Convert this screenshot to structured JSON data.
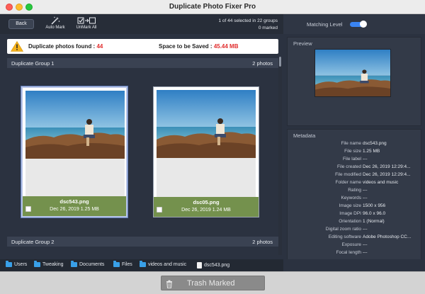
{
  "window": {
    "title": "Duplicate Photo Fixer Pro"
  },
  "toolbar": {
    "back_label": "Back",
    "auto_mark_label": "Auto Mark",
    "unmark_all_label": "UnMark All",
    "selection_info": "1 of 44 selected in 22 groups",
    "marked_info": "0 marked"
  },
  "matching": {
    "label": "Matching Level",
    "enabled": true,
    "accent": "#3a84f2"
  },
  "banner": {
    "dup_label": "Duplicate photos found : ",
    "dup_count": "44",
    "space_label": "Space to be Saved : ",
    "space_value": "45.44 MB",
    "value_color": "#e02a2a"
  },
  "groups": [
    {
      "name": "Duplicate Group 1",
      "count": "2 photos"
    },
    {
      "name": "Duplicate Group 2",
      "count": "2 photos"
    }
  ],
  "photos": [
    {
      "name": "dsc543.png",
      "meta": "Dec 26, 2019 1.25 MB",
      "selected": true,
      "checked": false
    },
    {
      "name": "dsc05.png",
      "meta": "Dec 26, 2019 1.24 MB",
      "selected": false,
      "checked": false
    }
  ],
  "preview": {
    "title": "Preview"
  },
  "metadata": {
    "title": "Metadata",
    "rows": [
      {
        "key": "File name",
        "value": "dsc543.png"
      },
      {
        "key": "File size",
        "value": "1.25 MB"
      },
      {
        "key": "File label",
        "value": "---"
      },
      {
        "key": "File created",
        "value": "Dec 26, 2019 12:29:4..."
      },
      {
        "key": "File modified",
        "value": "Dec 26, 2019 12:29:4..."
      },
      {
        "key": "Folder name",
        "value": "videos and music"
      },
      {
        "key": "Rating",
        "value": "---"
      },
      {
        "key": "Keywords",
        "value": "---"
      },
      {
        "key": "Image size",
        "value": "1500 x 956"
      },
      {
        "key": "Image DPI",
        "value": "96.0 x 96.0"
      },
      {
        "key": "Orientation",
        "value": "1 (Normal)"
      },
      {
        "key": "Digital zoom ratio",
        "value": "---"
      },
      {
        "key": "Editing software",
        "value": "Adobe Photoshop CC..."
      },
      {
        "key": "Exposure",
        "value": "---"
      },
      {
        "key": "Focal length",
        "value": "---"
      }
    ]
  },
  "path": [
    {
      "label": "Users",
      "icon": "folder-icon"
    },
    {
      "label": "Tweaking",
      "icon": "folder-icon"
    },
    {
      "label": "Documents",
      "icon": "folder-icon"
    },
    {
      "label": "Files",
      "icon": "folder-icon"
    },
    {
      "label": "videos and music",
      "icon": "folder-icon"
    },
    {
      "label": "dsc543.png",
      "icon": "file-icon"
    }
  ],
  "actions": {
    "trash_label": "Trash Marked"
  }
}
